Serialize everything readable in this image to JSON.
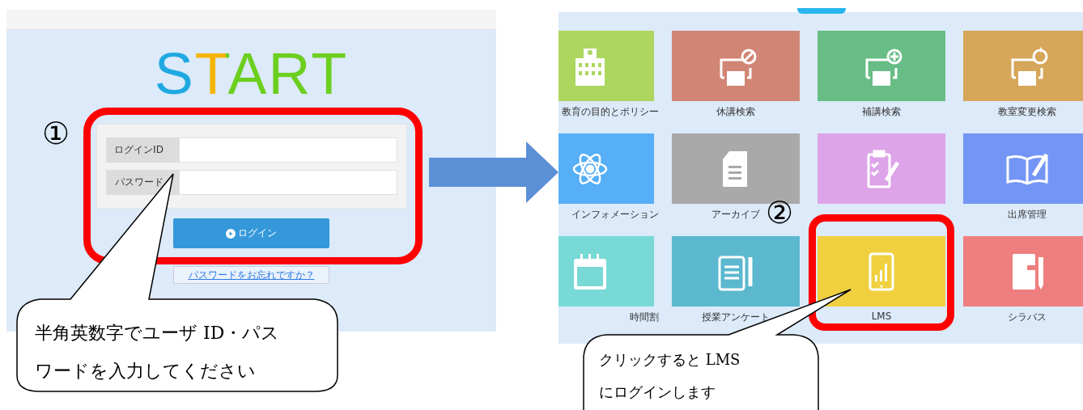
{
  "login_screen": {
    "logo": "START",
    "fields": [
      {
        "label": "ログインID"
      },
      {
        "label": "パスワード"
      }
    ],
    "login_button": "ログイン",
    "forgot_link": "パスワードをお忘れですか？"
  },
  "menu_screen": {
    "tiles": [
      {
        "label": "教育の目的とポリシー",
        "color": "#acd65e",
        "kind": "building"
      },
      {
        "label": "休講検索",
        "color": "#d18575",
        "kind": "projector-cancel"
      },
      {
        "label": "補講検索",
        "color": "#67bd85",
        "kind": "projector-add"
      },
      {
        "label": "教室変更検索",
        "color": "#d6a65a",
        "kind": "projector-refresh"
      },
      {
        "label": "インフォメーション",
        "color": "#56aff7",
        "kind": "atom"
      },
      {
        "label": "アーカイブ",
        "color": "#a9a9a9",
        "kind": "document"
      },
      {
        "color": "#dda4e9",
        "kind": "clipboard"
      },
      {
        "label": "出席管理",
        "color": "#7395f5",
        "kind": "book"
      },
      {
        "label": "時間割",
        "color": "#78d9d6",
        "kind": "calendar"
      },
      {
        "label": "授業アンケート",
        "color": "#5bb8cf",
        "kind": "survey"
      },
      {
        "label": "LMS",
        "color": "#f0d03f",
        "kind": "tablet"
      },
      {
        "label": "シラバス",
        "color": "#ef7f7f",
        "kind": "notebook"
      }
    ]
  },
  "annotations": [
    {
      "number": "①",
      "lines": [
        "半角英数字でユーザ ID・パス",
        "ワードを入力してください"
      ]
    },
    {
      "number": "②",
      "lines": [
        "クリックすると LMS",
        "にログインします"
      ]
    }
  ]
}
